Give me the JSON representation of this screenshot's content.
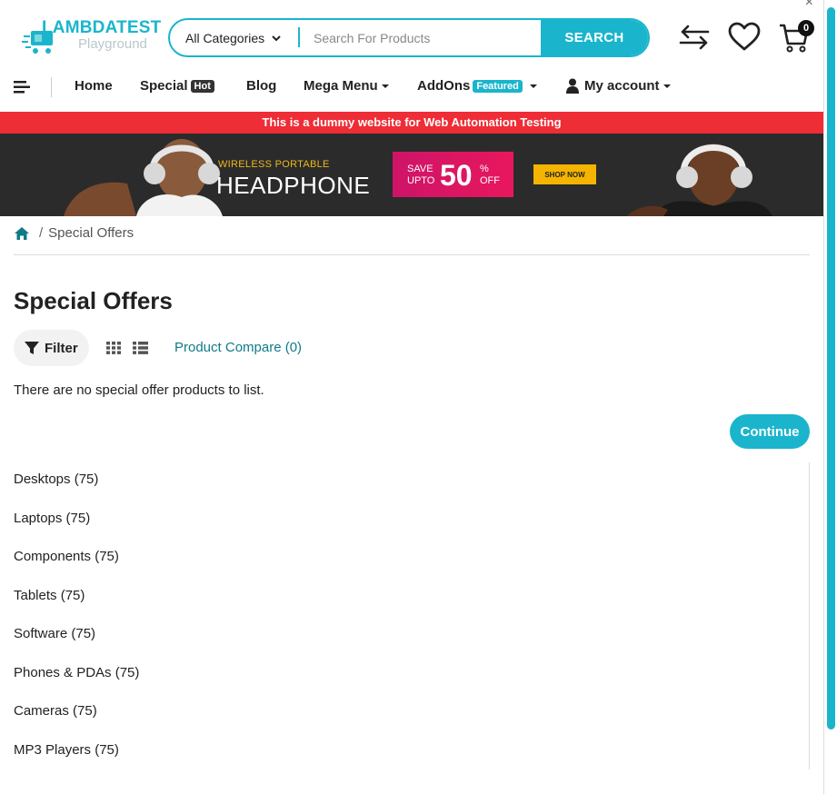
{
  "header": {
    "logo_title": "LAMBDATEST",
    "logo_sub": "Playground",
    "search": {
      "category": "All Categories",
      "placeholder": "Search For Products",
      "button": "SEARCH"
    },
    "cart_count": "0"
  },
  "nav": {
    "items": [
      {
        "label": "Home"
      },
      {
        "label": "Special",
        "tag": "Hot"
      },
      {
        "label": "Blog"
      },
      {
        "label": "Mega Menu"
      },
      {
        "label": "AddOns",
        "tag": "Featured"
      },
      {
        "label": "My account"
      }
    ]
  },
  "notice": "This is a dummy website for Web Automation Testing",
  "banner": {
    "eyebrow": "WIRELESS PORTABLE",
    "headline": "HEADPHONE",
    "save_line1": "SAVE",
    "save_line2": "UPTO",
    "percent_value": "50",
    "percent_sign": "%",
    "off": "OFF",
    "cta": "SHOP NOW"
  },
  "breadcrumb": {
    "current": "Special Offers"
  },
  "page": {
    "title": "Special Offers",
    "filter_label": "Filter",
    "compare_link": "Product Compare (0)",
    "empty_message": "There are no special offer products to list.",
    "continue_label": "Continue"
  },
  "categories": [
    "Desktops (75)",
    "Laptops (75)",
    "Components (75)",
    "Tablets (75)",
    "Software (75)",
    "Phones & PDAs (75)",
    "Cameras (75)",
    "MP3 Players (75)"
  ],
  "colors": {
    "accent": "#1ab5cc",
    "notice_bg": "#ee2d36",
    "banner_bg": "#2b2b2b",
    "sale_pink": "#e8175d",
    "cta_yellow": "#f4b400"
  }
}
